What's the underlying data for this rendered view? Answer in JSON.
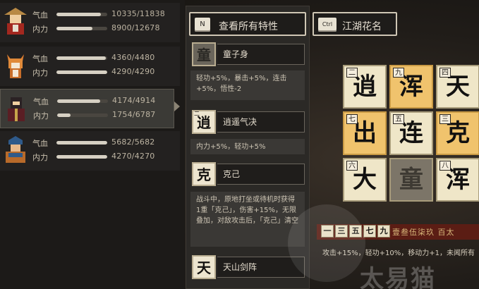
{
  "party": {
    "members": [
      {
        "hp_label": "气血",
        "mp_label": "内力",
        "hp_current": 10335,
        "hp_max": 11838,
        "mp_current": 8900,
        "mp_max": 12678,
        "hp_text": "10335/11838",
        "mp_text": "8900/12678",
        "selected": false
      },
      {
        "hp_label": "气血",
        "mp_label": "内力",
        "hp_current": 4360,
        "hp_max": 4480,
        "mp_current": 4290,
        "mp_max": 4290,
        "hp_text": "4360/4480",
        "mp_text": "4290/4290",
        "selected": false
      },
      {
        "hp_label": "气血",
        "mp_label": "内力",
        "hp_current": 4174,
        "hp_max": 4914,
        "mp_current": 1754,
        "mp_max": 6787,
        "hp_text": "4174/4914",
        "mp_text": "1754/6787",
        "selected": true
      },
      {
        "hp_label": "气血",
        "mp_label": "内力",
        "hp_current": 5682,
        "hp_max": 5682,
        "mp_current": 4270,
        "mp_max": 4270,
        "hp_text": "5682/5682",
        "mp_text": "4270/4270",
        "selected": false
      }
    ]
  },
  "header": {
    "view_all": {
      "key": "N",
      "label": "查看所有特性"
    },
    "jianghu": {
      "key": "Ctrl",
      "label": "江湖花名"
    }
  },
  "traits": [
    {
      "glyph": "童",
      "name": "童子身",
      "desc": "轻功+5%，暴击+5%，连击+5%，悟性-2",
      "locked": true
    },
    {
      "glyph": "逍",
      "name": "逍遥气决",
      "desc": "内力+5%，轻功+5%",
      "number": "二",
      "locked": false
    },
    {
      "glyph": "克",
      "name": "克己",
      "desc": "战斗中，原地打坐或待机时获得1重「克己」，伤害+15%，无限叠加，对敌攻击后，「克己」清空",
      "locked": false
    },
    {
      "glyph": "天",
      "name": "天山剑阵",
      "locked": false
    }
  ],
  "grid": [
    {
      "n": "二",
      "g": "逍",
      "style": "light"
    },
    {
      "n": "九",
      "g": "浑",
      "style": "gold"
    },
    {
      "n": "四",
      "g": "天",
      "style": "light"
    },
    {
      "n": "七",
      "g": "出",
      "style": "gold"
    },
    {
      "n": "五",
      "g": "连",
      "style": "light"
    },
    {
      "n": "三",
      "g": "克",
      "style": "gold"
    },
    {
      "n": "六",
      "g": "大",
      "style": "light"
    },
    {
      "n": "",
      "g": "童",
      "style": "center"
    },
    {
      "n": "八",
      "g": "浑",
      "style": "light"
    }
  ],
  "effect": {
    "mini_tiles": [
      "一",
      "三",
      "五",
      "七",
      "九"
    ],
    "title": "壹叁伍柒玖 百太",
    "desc": "攻击+15%，轻功+10%，移动力+1，未闻所有"
  },
  "watermark": "太易猫"
}
